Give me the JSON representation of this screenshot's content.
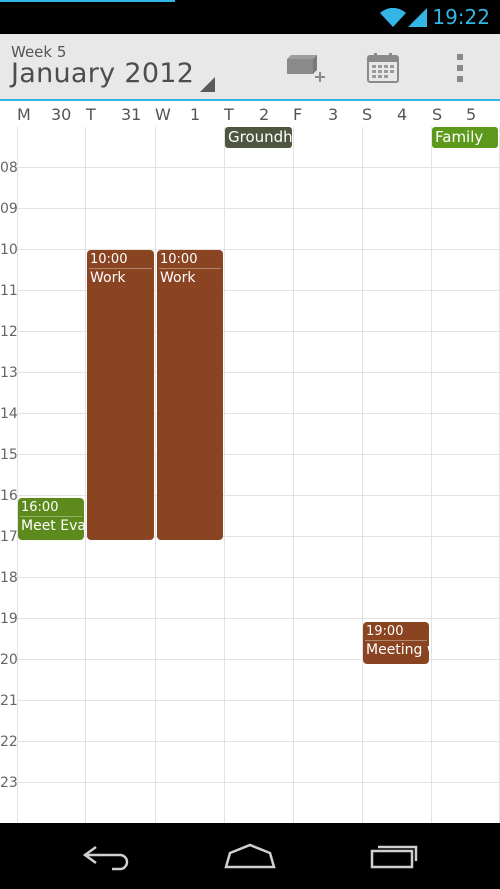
{
  "status_bar": {
    "time": "19:22"
  },
  "action_bar": {
    "week_label": "Week 5",
    "month_title": "January 2012"
  },
  "day_headers": [
    {
      "dow": "M",
      "date": "30"
    },
    {
      "dow": "T",
      "date": "31"
    },
    {
      "dow": "W",
      "date": "1"
    },
    {
      "dow": "T",
      "date": "2"
    },
    {
      "dow": "F",
      "date": "3"
    },
    {
      "dow": "S",
      "date": "4"
    },
    {
      "dow": "S",
      "date": "5"
    }
  ],
  "hours": [
    "08",
    "09",
    "10",
    "11",
    "12",
    "13",
    "14",
    "15",
    "16",
    "17",
    "18",
    "19",
    "20",
    "21",
    "22",
    "23"
  ],
  "all_day_events": [
    {
      "title": "Groundh",
      "color": "#4f5640"
    },
    {
      "title": "Family",
      "color": "#5d9a1c"
    }
  ],
  "events": [
    {
      "time": "10:00",
      "title": "Work",
      "color": "#8a4422"
    },
    {
      "time": "10:00",
      "title": "Work",
      "color": "#8a4422"
    },
    {
      "time": "16:00",
      "title": "Meet Eva",
      "color": "#5d8a1c"
    },
    {
      "time": "19:00",
      "title": "Meeting w",
      "color": "#8a4422"
    }
  ],
  "colors": {
    "accent": "#33b5e5"
  }
}
